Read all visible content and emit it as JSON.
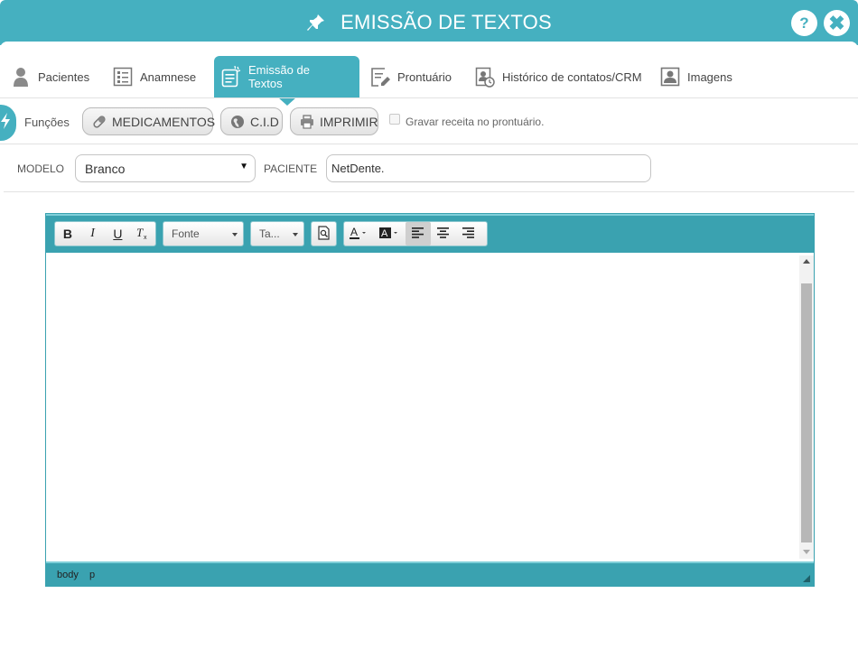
{
  "window": {
    "title": "EMISSÃO DE TEXTOS",
    "pin_icon": "pin-icon",
    "help_icon": "help-icon",
    "close_icon": "close-icon",
    "accent_color": "#45b0c0"
  },
  "tabs": [
    {
      "label": "Pacientes",
      "icon": "person-icon",
      "active": false
    },
    {
      "label": "Anamnese",
      "icon": "list-form-icon",
      "active": false
    },
    {
      "label": "Emissão de Textos",
      "icon": "text-document-icon",
      "active": true
    },
    {
      "label": "Prontuário",
      "icon": "edit-document-icon",
      "active": false
    },
    {
      "label": "Histórico de contatos/CRM",
      "icon": "contact-history-icon",
      "active": false
    },
    {
      "label": "Imagens",
      "icon": "image-portrait-icon",
      "active": false
    }
  ],
  "functions": {
    "label": "Funções",
    "buttons": [
      {
        "label": "MEDICAMENTOS",
        "icon": "pill-icon"
      },
      {
        "label": "C.I.D",
        "icon": "globe-icon"
      },
      {
        "label": "IMPRIMIR",
        "icon": "printer-icon"
      }
    ],
    "checkbox_label": "Gravar receita no prontuário.",
    "checkbox_checked": false
  },
  "form": {
    "model_label": "MODELO",
    "model_value": "Branco",
    "patient_label": "PACIENTE",
    "patient_value": "NetDente."
  },
  "editor": {
    "toolbar": {
      "bold": "B",
      "italic": "I",
      "underline": "U",
      "remove_format": "Tx",
      "font_combo": "Fonte",
      "size_combo": "Ta...",
      "preview_icon": "preview-icon",
      "text_color_icon": "text-color-icon",
      "bg_color_icon": "background-color-icon",
      "align_left_active": true
    },
    "content": "",
    "status_path": [
      "body",
      "p"
    ]
  }
}
